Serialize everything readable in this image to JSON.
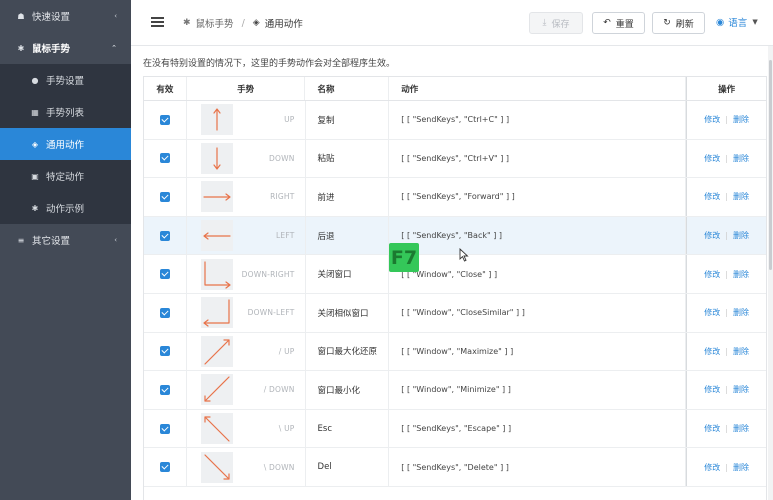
{
  "sidebar": {
    "items": [
      {
        "label": "快速设置",
        "icon": "home-icon",
        "chevron": "‹"
      },
      {
        "label": "鼠标手势",
        "icon": "gear-icon",
        "chevron": "⌃"
      }
    ],
    "sub_items": [
      {
        "label": "手势设置",
        "icon": "palette-icon"
      },
      {
        "label": "手势列表",
        "icon": "grid-icon"
      },
      {
        "label": "通用动作",
        "icon": "cube-icon"
      },
      {
        "label": "特定动作",
        "icon": "lock-icon"
      },
      {
        "label": "动作示例",
        "icon": "gear-icon"
      }
    ],
    "other": {
      "label": "其它设置",
      "icon": "sliders-icon",
      "chevron": "‹"
    }
  },
  "header": {
    "breadcrumb_parent": "鼠标手势",
    "breadcrumb_current": "通用动作",
    "save_label": "保存",
    "reset_label": "重置",
    "refresh_label": "刷新",
    "language_label": "语言"
  },
  "notice": "在没有特别设置的情况下，这里的手势动作会对全部程序生效。",
  "table": {
    "headers": {
      "enabled": "有效",
      "gesture": "手势",
      "name": "名称",
      "action": "动作",
      "ops": "操作"
    },
    "edit_label": "修改",
    "delete_label": "删除",
    "rows": [
      {
        "gesture": "UP",
        "name": "复制",
        "action": "[ [ \"SendKeys\", \"Ctrl+C\" ] ]"
      },
      {
        "gesture": "DOWN",
        "name": "粘贴",
        "action": "[ [ \"SendKeys\", \"Ctrl+V\" ] ]"
      },
      {
        "gesture": "RIGHT",
        "name": "前进",
        "action": "[ [ \"SendKeys\", \"Forward\" ] ]"
      },
      {
        "gesture": "LEFT",
        "name": "后退",
        "action": "[ [ \"SendKeys\", \"Back\" ] ]"
      },
      {
        "gesture": "DOWN-RIGHT",
        "name": "关闭窗口",
        "action": "[ [ \"Window\", \"Close\" ] ]"
      },
      {
        "gesture": "DOWN-LEFT",
        "name": "关闭相似窗口",
        "action": "[ [ \"Window\", \"CloseSimilar\" ] ]"
      },
      {
        "gesture": "/ UP",
        "name": "窗口最大化还原",
        "action": "[ [ \"Window\", \"Maximize\" ] ]"
      },
      {
        "gesture": "/ DOWN",
        "name": "窗口最小化",
        "action": "[ [ \"Window\", \"Minimize\" ] ]"
      },
      {
        "gesture": "\\ UP",
        "name": "Esc",
        "action": "[ [ \"SendKeys\", \"Escape\" ] ]"
      },
      {
        "gesture": "\\ DOWN",
        "name": "Del",
        "action": "[ [ \"SendKeys\", \"Delete\" ] ]"
      }
    ]
  },
  "overlay": {
    "key_label": "F7"
  },
  "colors": {
    "accent": "#2a87d8",
    "sidebar": "#434a56",
    "submenu": "#2f3540",
    "arrow": "#e8734a",
    "key_badge": "#34c759"
  }
}
